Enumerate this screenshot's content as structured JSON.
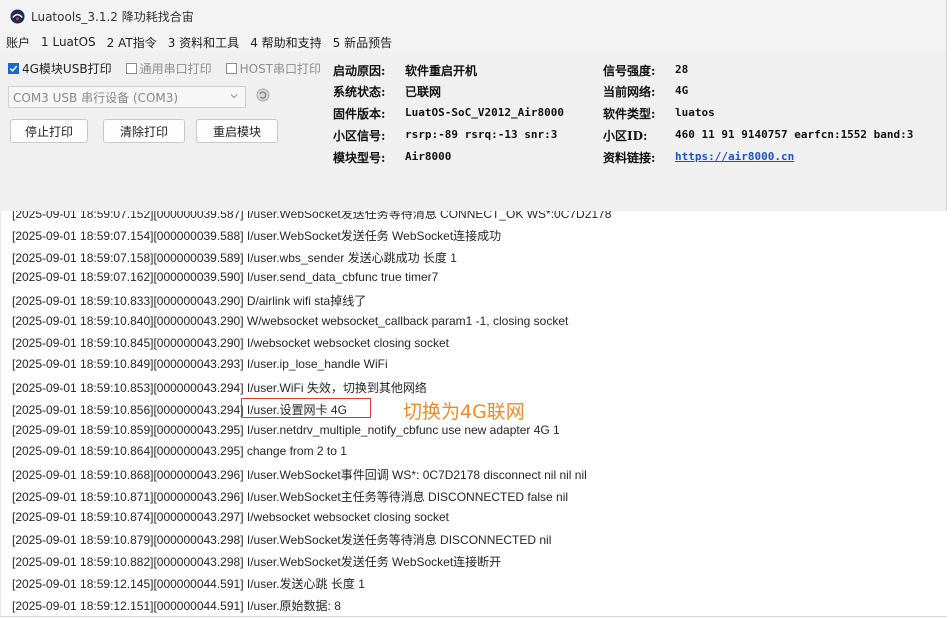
{
  "window": {
    "title": "Luatools_3.1.2 降功耗找合宙"
  },
  "menu": [
    "账户",
    "1 LuatOS",
    "2 AT指令",
    "3 资料和工具",
    "4 帮助和支持",
    "5 新品预告"
  ],
  "options": {
    "usb_print": {
      "label": "4G模块USB打印",
      "checked": true
    },
    "serial_print": {
      "label": "通用串口打印",
      "checked": false
    },
    "host_print": {
      "label": "HOST串口打印",
      "checked": false
    }
  },
  "port_select": {
    "value": "COM3 USB 串行设备 (COM3)"
  },
  "buttons": {
    "stop": "停止打印",
    "clear": "清除打印",
    "restart": "重启模块"
  },
  "status": {
    "boot_reason_label": "启动原因:",
    "boot_reason": "软件重启开机",
    "sys_state_label": "系统状态:",
    "sys_state": "已联网",
    "firmware_label": "固件版本:",
    "firmware": "LuatOS-SoC_V2012_Air8000",
    "cell_signal_label": "小区信号:",
    "cell_signal": "rsrp:-89 rsrq:-13 snr:3",
    "model_label": "模块型号:",
    "model": "Air8000",
    "signal_label": "信号强度:",
    "signal": "28",
    "network_label": "当前网络:",
    "network": "4G",
    "software_label": "软件类型:",
    "software": "luatos",
    "cell_id_label": "小区ID:",
    "cell_id": "460 11 91 9140757 earfcn:1552 band:3",
    "link_label": "资料链接:",
    "link": "https://air8000.cn"
  },
  "log_lines": [
    "[2025-09-01 18:59:07.152][000000039.587] I/user.WebSocket发送任务等待消息 CONNECT_OK WS*:0C7D2178",
    "[2025-09-01 18:59:07.154][000000039.588] I/user.WebSocket发送任务 WebSocket连接成功",
    "[2025-09-01 18:59:07.158][000000039.589] I/user.wbs_sender 发送心跳成功 长度 1",
    "[2025-09-01 18:59:07.162][000000039.590] I/user.send_data_cbfunc true timer7",
    "[2025-09-01 18:59:10.833][000000043.290] D/airlink wifi sta掉线了",
    "[2025-09-01 18:59:10.840][000000043.290] W/websocket websocket_callback param1 -1, closing socket",
    "[2025-09-01 18:59:10.845][000000043.290] I/websocket websocket closing socket",
    "[2025-09-01 18:59:10.849][000000043.293] I/user.ip_lose_handle WiFi",
    "[2025-09-01 18:59:10.853][000000043.294] I/user.WiFi 失效，切换到其他网络",
    "[2025-09-01 18:59:10.856][000000043.294] I/user.设置网卡 4G",
    "[2025-09-01 18:59:10.859][000000043.295] I/user.netdrv_multiple_notify_cbfunc use new adapter 4G 1",
    "[2025-09-01 18:59:10.864][000000043.295] change from 2 to 1",
    "[2025-09-01 18:59:10.868][000000043.296] I/user.WebSocket事件回调 WS*: 0C7D2178 disconnect nil nil nil",
    "[2025-09-01 18:59:10.871][000000043.296] I/user.WebSocket主任务等待消息 DISCONNECTED false nil",
    "[2025-09-01 18:59:10.874][000000043.297] I/websocket websocket closing socket",
    "[2025-09-01 18:59:10.879][000000043.298] I/user.WebSocket发送任务等待消息 DISCONNECTED nil",
    "[2025-09-01 18:59:10.882][000000043.298] I/user.WebSocket发送任务 WebSocket连接断开",
    "[2025-09-01 18:59:12.145][000000044.591] I/user.发送心跳 长度 1",
    "[2025-09-01 18:59:12.151][000000044.591] I/user.原始数据: 8"
  ],
  "annotation": {
    "text": "切换为4G联网",
    "color": "#f08a24",
    "box_color": "#e03a2a"
  },
  "colors": {
    "accent": "#1a66c9",
    "link": "#1a52c9"
  }
}
